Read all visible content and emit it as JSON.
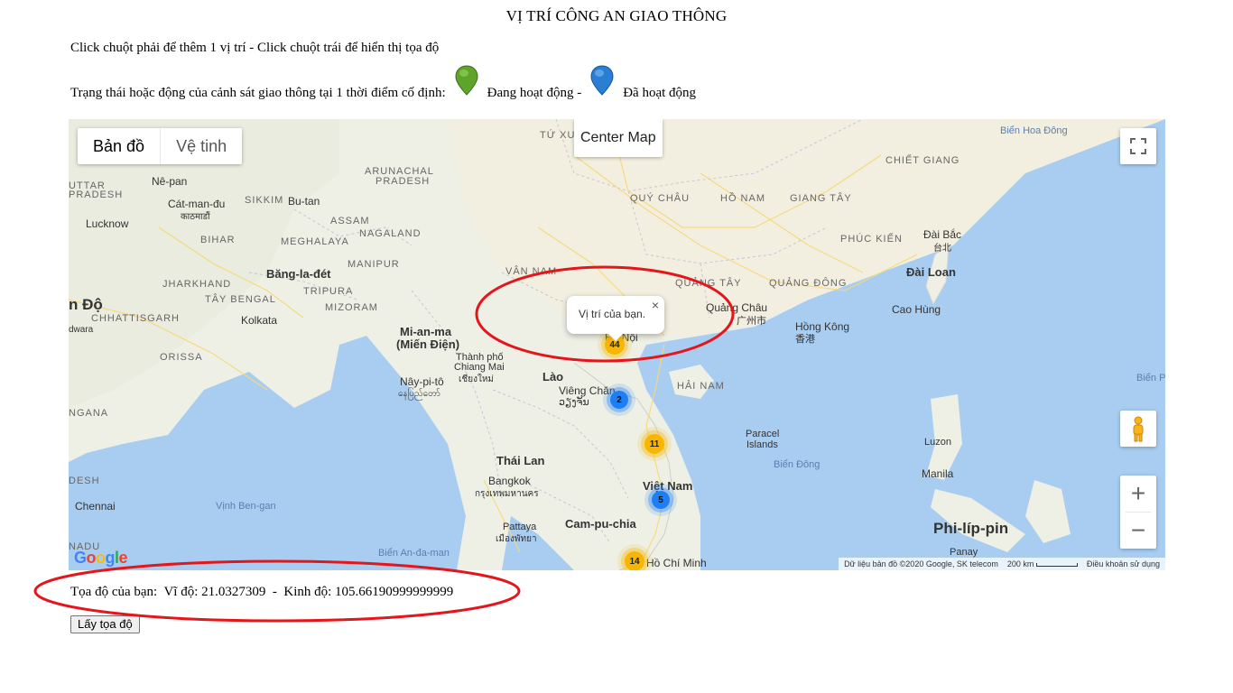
{
  "page": {
    "title": "VỊ TRÍ CÔNG AN GIAO THÔNG",
    "instruction": "Click chuột phải để thêm 1 vị trí - Click chuột trái để hiển thị tọa độ",
    "status_legend": {
      "prefix": "Trạng thái hoặc động của cảnh sát giao thông tại 1 thời điểm cố định:",
      "active_label": "Đang hoạt động -",
      "active_color": "#5fa32a",
      "done_label": "Đã hoạt động",
      "done_color": "#2a7fd4"
    }
  },
  "map": {
    "type_controls": {
      "map": "Bản đồ",
      "satellite": "Vệ tinh"
    },
    "center_button": "Center Map",
    "infowindow": {
      "text": "Vị trí của bạn.",
      "close": "×"
    },
    "clusters": [
      {
        "count": "44",
        "color": "yellow"
      },
      {
        "count": "2",
        "color": "blue"
      },
      {
        "count": "11",
        "color": "yellow"
      },
      {
        "count": "5",
        "color": "blue"
      },
      {
        "count": "14",
        "color": "yellow"
      }
    ],
    "labels": {
      "tu_xuyen": "TỨ XUYÊN",
      "bien_hoa_dong": "Biển Hoa Đông",
      "chiet_giang": "CHIẾT GIANG",
      "nepan": "Nê-pan",
      "uttar": "UTTAR",
      "pradesh": "PRADESH",
      "arunachal": "ARUNACHAL",
      "pradesh2": "PRADESH",
      "catmandu": "Cát-man-đu",
      "catmandu_local": "काठमाडौं",
      "sikkim": "SIKKIM",
      "butan": "Bu-tan",
      "quy_chau": "QUÝ CHÂU",
      "ho_nam": "HỒ NAM",
      "giang_tay": "GIANG TÂY",
      "lucknow": "Lucknow",
      "assam": "ASSAM",
      "nagaland": "NAGALAND",
      "dai_bac": "Đài Bắc",
      "dai_bac_local": "台北",
      "bihar": "BIHAR",
      "meghalaya": "MEGHALAYA",
      "phuc_kien": "PHÚC KIẾN",
      "manipur": "MANIPUR",
      "bangladet": "Băng-la-đét",
      "van_nam": "VÂN NAM",
      "dai_loan": "Đài Loan",
      "jharkhand": "JHARKHAND",
      "quang_tay": "QUẢNG TÂY",
      "quang_dong": "QUẢNG ĐÔNG",
      "tay_bengal": "TÂY BENGAL",
      "tripura": "TRIPURA",
      "mizoram": "MIZORAM",
      "quang_chau": "Quảng Châu",
      "quang_chau_local": "广州市",
      "cao_hung": "Cao Hùng",
      "an_do": "n Độ",
      "chhattisgarh": "CHHATTISGARH",
      "kolkata": "Kolkata",
      "hong_kong": "Hồng Kông",
      "hong_kong_local": "香港",
      "dwara": "dwara",
      "mianma": "Mi-an-ma",
      "mien_dien": "(Miến Điện)",
      "ha_noi": "Hà Nội",
      "orissa": "ORISSA",
      "thanh_pho": "Thành phố",
      "chiang_mai": "Chiang Mai",
      "chiang_mai_local": "เชียงใหม่",
      "lao": "Lào",
      "hai_nam": "HẢI NAM",
      "bien_p": "Biển P",
      "naypyito": "Nây-pi-tô",
      "naypyito_local": "နေပြည်တော်",
      "vieng_chan": "Viêng Chăn",
      "vieng_chan_local": "ວຽງຈັນ",
      "ngana": "NGANA",
      "paracel": "Paracel",
      "islands": "Islands",
      "luzon": "Luzon",
      "thai_lan": "Thái Lan",
      "bien_dong": "Biển Đông",
      "desh": "DESH",
      "bangkok": "Bangkok",
      "bangkok_local": "กรุงเทพมหานคร",
      "viet_nam": "Việt Nam",
      "manila": "Manila",
      "chennai": "Chennai",
      "vinh_bengan": "Vịnh Ben-gan",
      "pattaya": "Pattaya",
      "pattaya_local": "เมืองพัทยา",
      "campuchia": "Cam-pu-chia",
      "philippin": "Phi-líp-pin",
      "nadu": "NADU",
      "bien_andaman": "Biển An-đa-man",
      "panay": "Panay",
      "ho_chi_minh": "Hồ Chí Minh"
    },
    "footer": {
      "data": "Dữ liệu bản đồ ©2020 Google, SK telecom",
      "scale": "200 km",
      "terms": "Điều khoản sử dụng"
    },
    "google_logo": "Google"
  },
  "coords": {
    "label": "Tọa độ của bạn:",
    "lat_label": "Vĩ độ:",
    "lat": "21.0327309",
    "separator": "-",
    "lng_label": "Kinh độ:",
    "lng": "105.66190999999999"
  },
  "button": {
    "get_coords": "Lấy tọa độ"
  }
}
